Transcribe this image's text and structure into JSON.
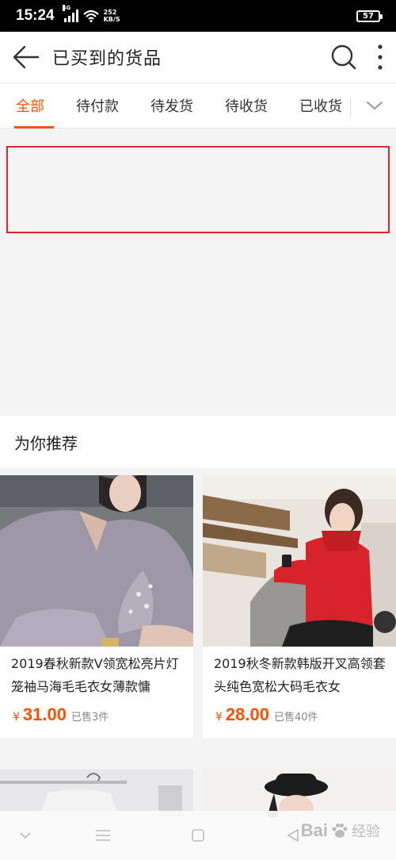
{
  "status_bar": {
    "time": "15:24",
    "network_type": "4G",
    "net_speed_value": "252",
    "net_speed_unit": "KB/S",
    "battery": "57"
  },
  "header": {
    "title": "已买到的货品",
    "back_icon": "arrow-left-icon",
    "search_icon": "search-icon",
    "more_icon": "more-vertical-icon"
  },
  "tabs": [
    {
      "label": "全部",
      "active": true
    },
    {
      "label": "待付款",
      "active": false
    },
    {
      "label": "待发货",
      "active": false
    },
    {
      "label": "待收货",
      "active": false
    },
    {
      "label": "已收货",
      "active": false
    }
  ],
  "expand_icon": "chevron-down-icon",
  "recommend": {
    "title": "为你推荐",
    "products": [
      {
        "title": "2019春秋新款V领宽松亮片灯笼袖马海毛毛衣女薄款慵",
        "price_symbol": "¥",
        "price": "31.00",
        "sold": "已售3件"
      },
      {
        "title": "2019秋冬新款韩版开叉高领套头纯色宽松大码毛衣女",
        "price_symbol": "¥",
        "price": "28.00",
        "sold": "已售40件"
      }
    ]
  },
  "watermark": {
    "text": "Bai",
    "suffix": "经验"
  },
  "colors": {
    "accent": "#ff5000",
    "highlight": "#e0262d"
  }
}
